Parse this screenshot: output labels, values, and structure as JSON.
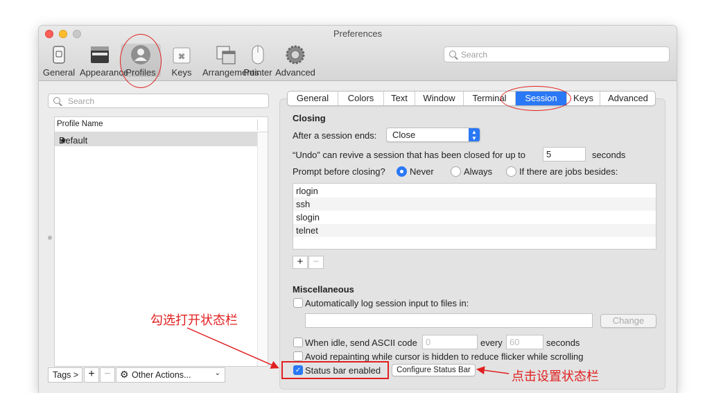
{
  "window": {
    "title": "Preferences"
  },
  "toolbar": {
    "items": [
      {
        "label": "General",
        "icon": "general-switch-icon"
      },
      {
        "label": "Appearance",
        "icon": "appearance-window-icon"
      },
      {
        "label": "Profiles",
        "icon": "profiles-person-icon"
      },
      {
        "label": "Keys",
        "icon": "keys-command-icon"
      },
      {
        "label": "Arrangements",
        "icon": "arrangements-windows-icon"
      },
      {
        "label": "Pointer",
        "icon": "pointer-mouse-icon"
      },
      {
        "label": "Advanced",
        "icon": "advanced-gear-icon"
      }
    ],
    "selected": "Profiles",
    "search_placeholder": "Search"
  },
  "profiles": {
    "search_placeholder": "Search",
    "column_header": "Profile Name",
    "rows": [
      {
        "star": "★",
        "name": "Default"
      }
    ],
    "tags_label": "Tags >",
    "add_label": "+",
    "remove_label": "−",
    "other_actions_label": "Other Actions..."
  },
  "tabs": {
    "items": [
      "General",
      "Colors",
      "Text",
      "Window",
      "Terminal",
      "Session",
      "Keys",
      "Advanced"
    ],
    "selected": "Session"
  },
  "closing": {
    "title": "Closing",
    "after_ends_label": "After a session ends:",
    "after_ends_value": "Close",
    "undo_prefix": "“Undo” can revive a session that has been closed for up to",
    "undo_value": "5",
    "undo_suffix": "seconds",
    "prompt_label": "Prompt before closing?",
    "prompt_options": [
      "Never",
      "Always",
      "If there are jobs besides:"
    ],
    "prompt_selected": "Never",
    "jobs": [
      "rlogin",
      "ssh",
      "slogin",
      "telnet"
    ],
    "add_label": "+",
    "remove_label": "−"
  },
  "misc": {
    "title": "Miscellaneous",
    "autolog_label": "Automatically log session input to files in:",
    "autolog_checked": false,
    "autolog_path": "",
    "change_label": "Change",
    "idle_label": "When idle, send ASCII code",
    "idle_checked": false,
    "idle_code": "0",
    "every_label": "every",
    "idle_every": "60",
    "seconds_label": "seconds",
    "avoid_label": "Avoid repainting while cursor is hidden to reduce flicker while scrolling",
    "avoid_checked": false,
    "statusbar_label": "Status bar enabled",
    "statusbar_checked": true,
    "configure_label": "Configure Status Bar"
  },
  "annotations": {
    "left_note": "勾选打开状态栏",
    "right_note": "点击设置状态栏",
    "color": "#e02020"
  },
  "colors": {
    "accent": "#2a78f5",
    "traffic_close": "#fc5f57",
    "traffic_min": "#fdbc2e",
    "traffic_zoom": "#c8c8c8"
  }
}
